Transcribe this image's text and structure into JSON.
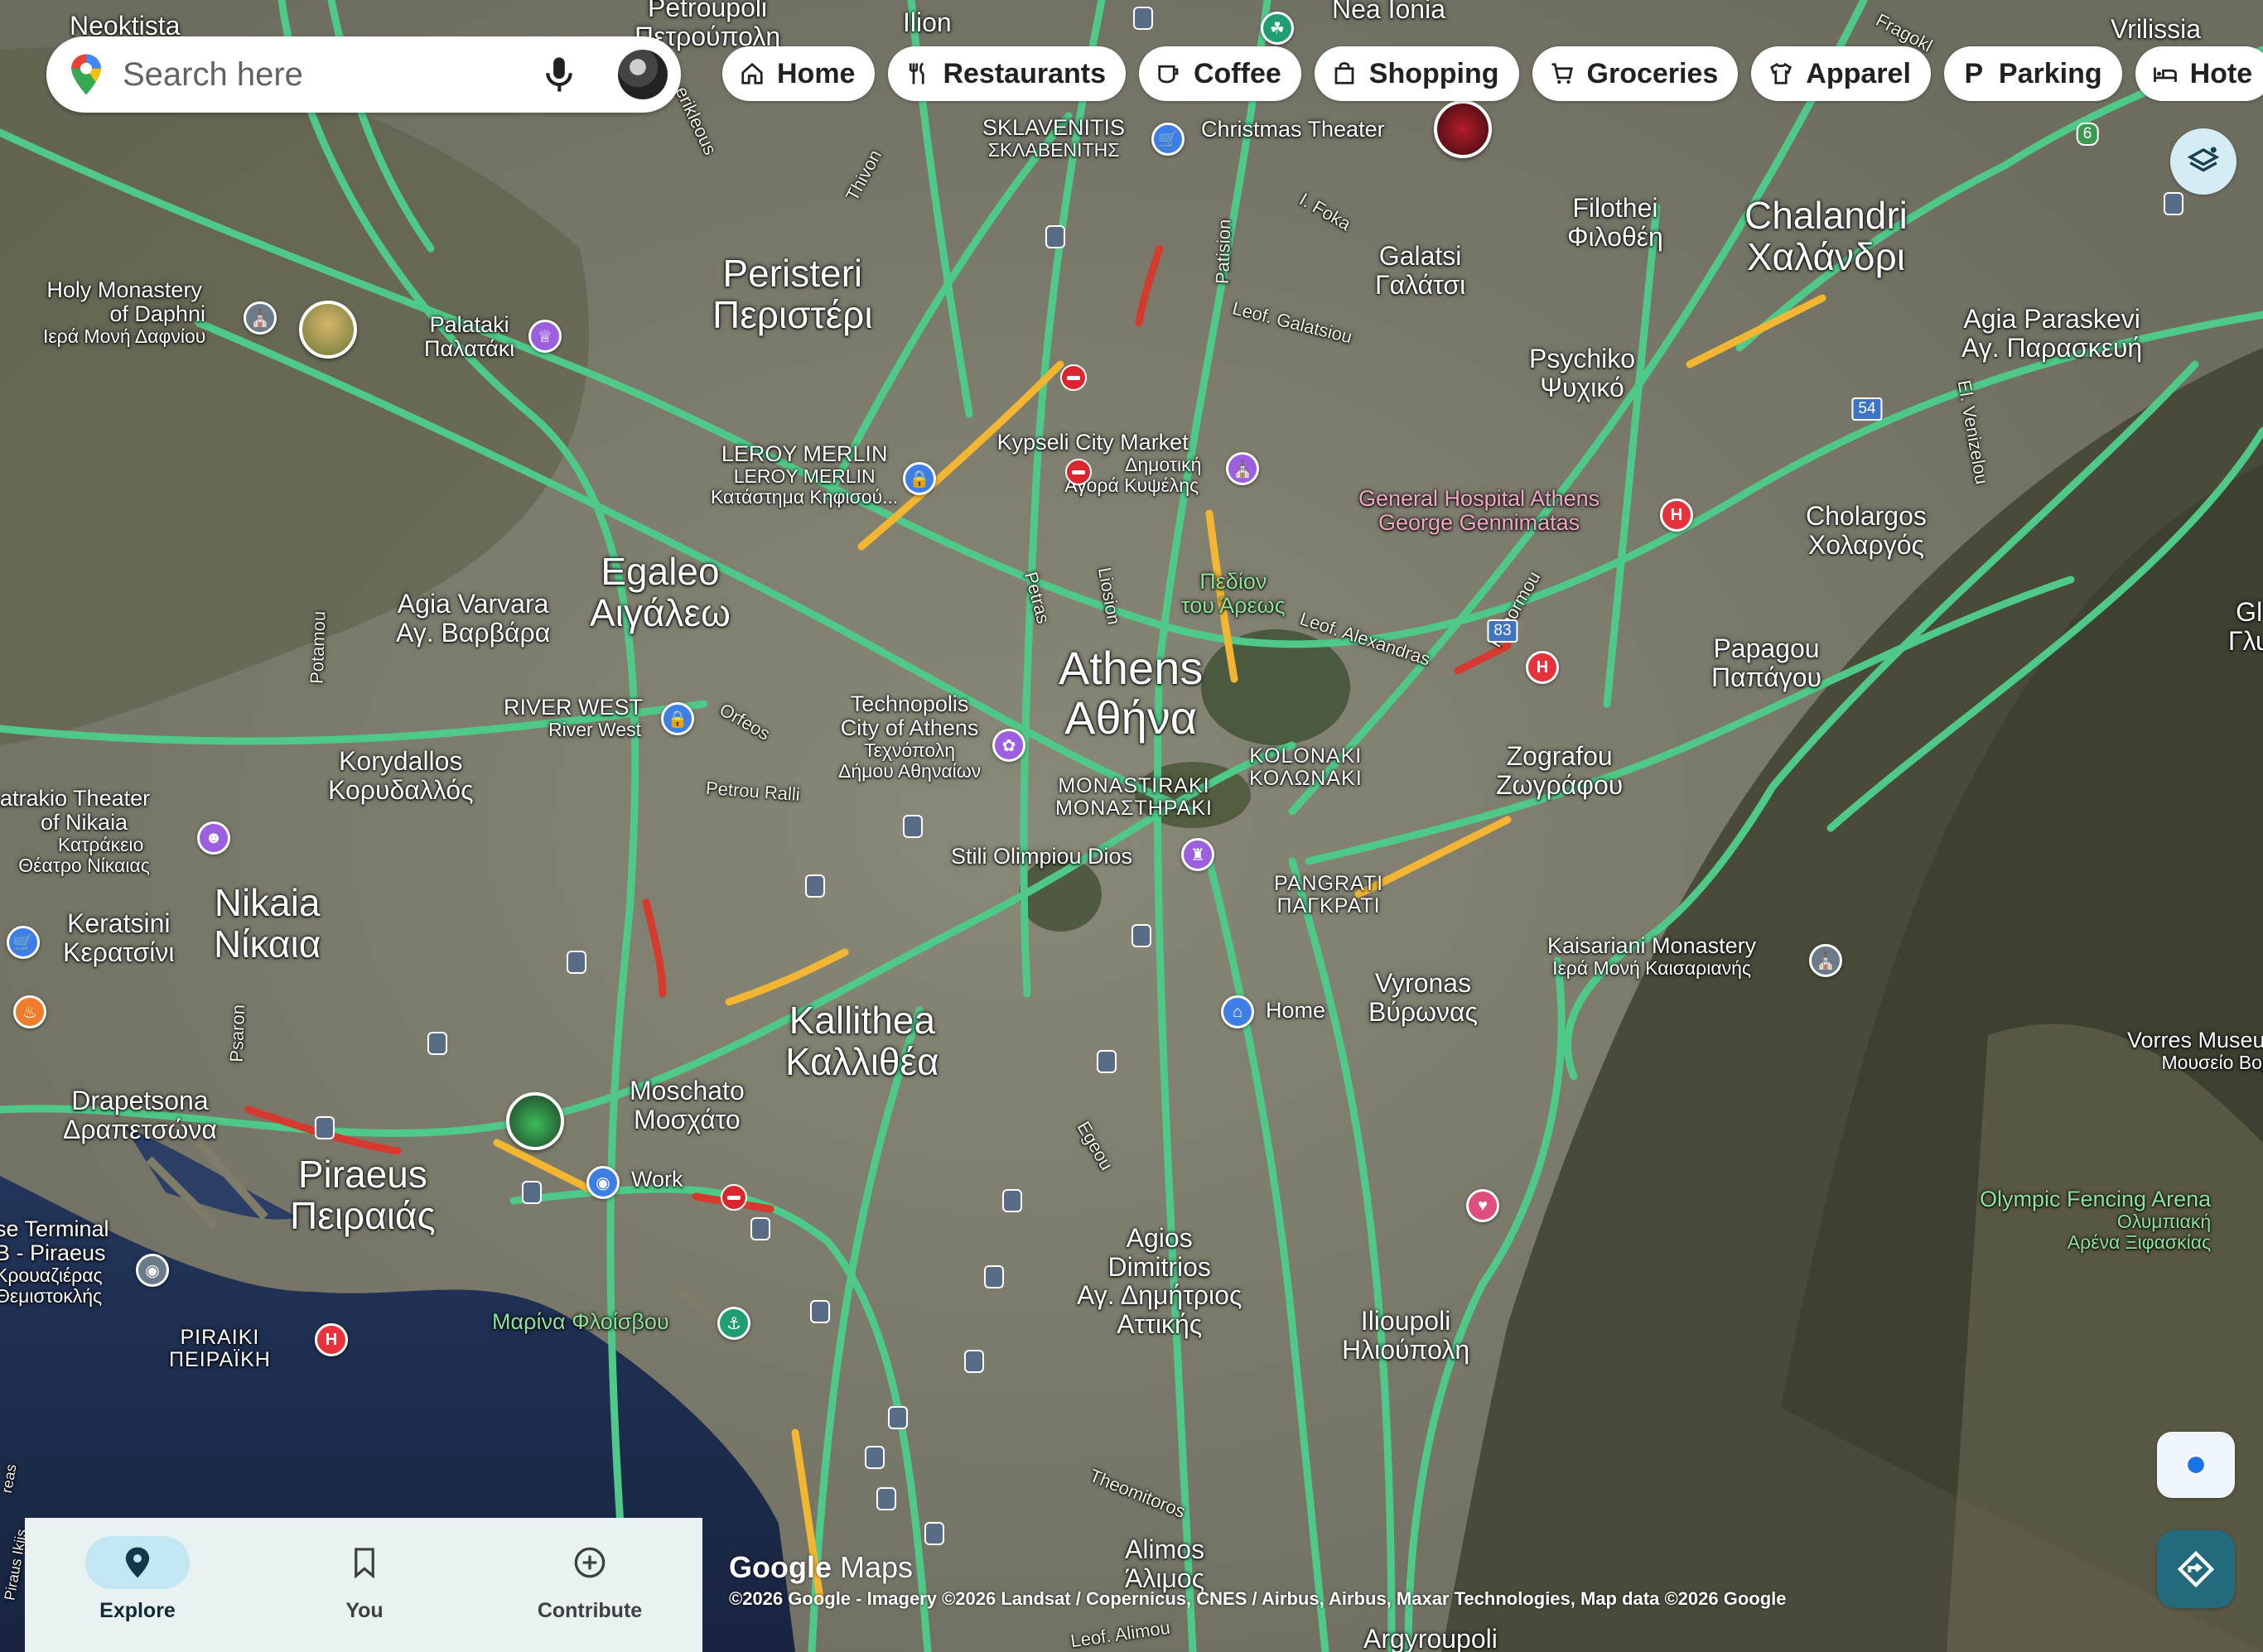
{
  "search": {
    "placeholder": "Search here"
  },
  "chips": [
    {
      "label": "Home",
      "icon": "home-icon"
    },
    {
      "label": "Restaurants",
      "icon": "fork-knife-icon"
    },
    {
      "label": "Coffee",
      "icon": "coffee-cup-icon"
    },
    {
      "label": "Shopping",
      "icon": "shopping-bag-icon"
    },
    {
      "label": "Groceries",
      "icon": "cart-icon"
    },
    {
      "label": "Apparel",
      "icon": "shirt-icon"
    },
    {
      "label": "Parking",
      "icon": "parking-icon"
    },
    {
      "label": "Hote",
      "icon": "bed-icon"
    }
  ],
  "map": {
    "places": {
      "athens_en": "Athens",
      "athens_gr": "Αθήνα",
      "peristeri_en": "Peristeri",
      "peristeri_gr": "Περιστέρι",
      "egaleo_en": "Egaleo",
      "egaleo_gr": "Αιγάλεω",
      "kallithea_en": "Kallithea",
      "kallithea_gr": "Καλλιθέα",
      "piraeus_en": "Piraeus",
      "piraeus_gr": "Πειραιάς",
      "nikaia_en": "Nikaia",
      "nikaia_gr": "Νίκαια",
      "chalandri_en": "Chalandri",
      "chalandri_gr": "Χαλάνδρι",
      "neoktista": "Neoktista",
      "petroupoli_en": "Petroupoli",
      "petroupoli_gr": "Πετρούπολη",
      "ilion": "Ilion",
      "nea_ionia": "Nea Ionia",
      "vrilissia": "Vrilissia",
      "filothei_en": "Filothei",
      "filothei_gr": "Φιλοθέη",
      "galatsi_en": "Galatsi",
      "galatsi_gr": "Γαλάτσι",
      "psychiko_en": "Psychiko",
      "psychiko_gr": "Ψυχικό",
      "agia_paraskevi_en": "Agia Paraskevi",
      "agia_paraskevi_gr": "Αγ. Παρασκευή",
      "cholargos_en": "Cholargos",
      "cholargos_gr": "Χολαργός",
      "papagou_en": "Papagou",
      "papagou_gr": "Παπάγου",
      "zografou_en": "Zografou",
      "zografou_gr": "Ζωγράφου",
      "vyronas_en": "Vyronas",
      "vyronas_gr": "Βύρωνας",
      "ilioupoli_en": "Ilioupoli",
      "ilioupoli_gr": "Ηλιούπολη",
      "agios_dimitrios_1": "Agios",
      "agios_dimitrios_2": "Dimitrios",
      "agios_dimitrios_3": "Αγ. Δημήτριος",
      "agios_dimitrios_4": "Αττικής",
      "alimos_en": "Alimos",
      "alimos_gr": "Άλιμος",
      "argyroupoli": "Argyroupoli",
      "moschato_en": "Moschato",
      "moschato_gr": "Μοσχάτο",
      "drapetsona_en": "Drapetsona",
      "drapetsona_gr": "Δραπετσώνα",
      "keratsini_en": "Keratsini",
      "keratsini_gr": "Κερατσίνι",
      "korydallos_en": "Korydallos",
      "korydallos_gr": "Κορυδαλλός",
      "agia_varvara_en": "Agia Varvara",
      "agia_varvara_gr": "Αγ. Βαρβάρα",
      "palataki_en": "Palataki",
      "palataki_gr": "Παλατάκι",
      "kolonaki_en": "KOLONAKI",
      "kolonaki_gr": "ΚΟΛΩΝΑΚΙ",
      "monastiraki_en": "MONASTIRAKI",
      "monastiraki_gr": "ΜΟΝΑΣΤΗΡΑΚΙ",
      "pangrati_en": "PANGRATI",
      "pangrati_gr": "ΠΑΓΚΡΑΤΙ",
      "piraiki_en": "PIRAIKI",
      "piraiki_gr": "ΠΕΙΡΑΪΚΗ",
      "gl_edge": "Gl",
      "gl_edge_gr": "Γλυ"
    },
    "pois": {
      "sklavenitis_en": "SKLAVENITIS",
      "sklavenitis_gr": "ΣΚΛΑΒΕΝΙΤΗΣ",
      "christmas_theater": "Christmas Theater",
      "holy_monastery_1": "Holy Monastery",
      "holy_monastery_2": "of Daphni",
      "holy_monastery_gr": "Ιερά Μονή Δαφνίου",
      "leroy_en": "LEROY MERLIN",
      "leroy_gr": "LEROY MERLIN",
      "leroy_sub": "Κατάστημα Κηφισού...",
      "kypseli_en": "Kypseli City Market",
      "kypseli_gr1": "Δημοτική",
      "kypseli_gr2": "Αγορά Κυψέλης",
      "hospital_1": "General Hospital Athens",
      "hospital_2": "George Gennimatas",
      "pedion_1": "Πεδίον",
      "pedion_2": "του Άρεως",
      "river_west_en": "RIVER WEST",
      "river_west_sub": "River West",
      "technopolis_1": "Technopolis",
      "technopolis_2": "City of Athens",
      "technopolis_gr1": "Τεχνόπολη",
      "technopolis_gr2": "Δήμου Αθηναίων",
      "stili": "Stili Olimpiou Dios",
      "home_label": "Home",
      "work_label": "Work",
      "katrakio_1": "Katrakio Theater",
      "katrakio_2": "of Nikaia",
      "katrakio_gr1": "Κατράκειο",
      "katrakio_gr2": "Θέατρο Νίκαιας",
      "kaisariani_en": "Kaisariani Monastery",
      "kaisariani_gr": "Ιερά Μονή Καισαριανής",
      "vorres_en": "Vorres Museum",
      "vorres_gr": "Μουσείο Βορρ",
      "olympic_1": "Olympic Fencing Arena",
      "olympic_gr1": "Ολυμπιακή",
      "olympic_gr2": "Αρένα Ξιφασκίας",
      "marina": "Μαρίνα Φλοίσβου",
      "cruise_1": "se Terminal",
      "cruise_2": "B - Piraeus",
      "cruise_gr1": "Κρουαζιέρας",
      "cruise_gr2": "Θεμιστοκλής"
    },
    "streets": {
      "thivon": "Thivon",
      "patision": "Patision",
      "foka": "I. Foka",
      "galatsiou": "Leof. Galatsiou",
      "petras": "Petras",
      "liosion": "Liosion",
      "alexandras": "Leof. Alexandras",
      "panormou": "Panormou",
      "orfeos": "Orfeos",
      "petrou_ralli": "Petrou Ralli",
      "potamou": "Potamou",
      "psaron": "Psaron",
      "egeou": "Egeou",
      "theomitoros": "Theomitoros",
      "alimou": "Leof. Alimou",
      "venizelou": "El. Venizelou",
      "kifisou": "erikleous",
      "frag": "Fragokl",
      "pireos": "Piraus Ikiis",
      "pireos2": "reas"
    },
    "shields": {
      "r54": "54",
      "r83": "83",
      "r6": "6"
    }
  },
  "controls": {
    "layers": "layers-icon",
    "locate": "my-location-icon",
    "directions": "directions-icon"
  },
  "nav": [
    {
      "label": "Explore",
      "icon": "explore-pin-icon",
      "active": true
    },
    {
      "label": "You",
      "icon": "bookmark-icon",
      "active": false
    },
    {
      "label": "Contribute",
      "icon": "add-circle-icon",
      "active": false
    }
  ],
  "brand": {
    "google": "Google",
    "maps": "Maps"
  },
  "attribution": "©2026 Google - Imagery ©2026 Landsat / Copernicus, CNES / Airbus, Airbus, Maxar Technologies, Map data ©2026 Google",
  "colors": {
    "traffic_green": "#4fc987",
    "traffic_yellow": "#f2b632",
    "traffic_red": "#d6392d",
    "sea": "#1c2c4c",
    "chip_bg": "#ffffff"
  }
}
